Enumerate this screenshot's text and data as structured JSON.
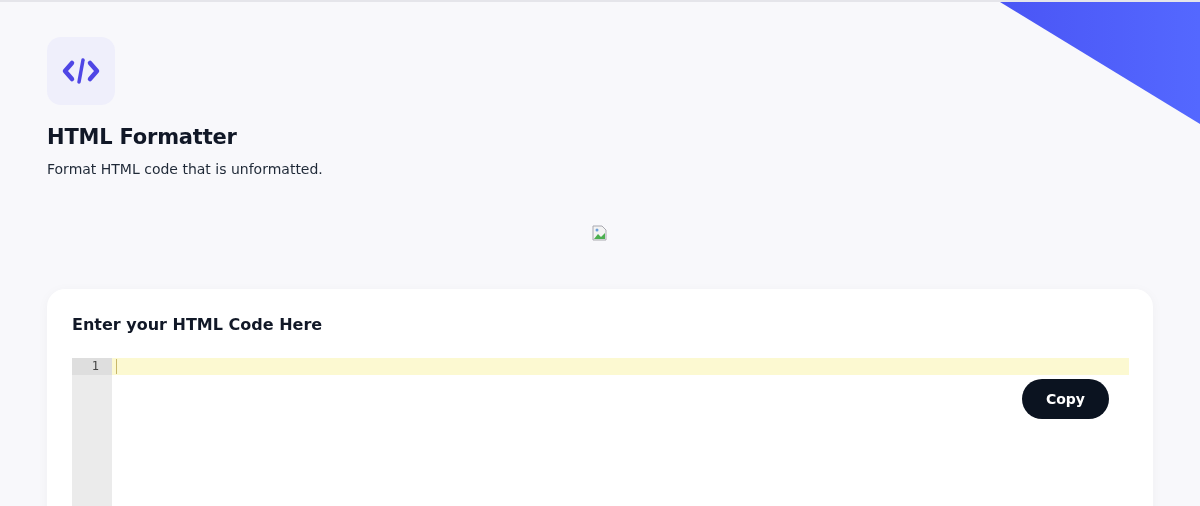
{
  "tool": {
    "title": "HTML Formatter",
    "description": "Format HTML code that is unformatted."
  },
  "editor_card": {
    "heading": "Enter your HTML Code Here",
    "lines": [
      {
        "number": "1",
        "active": true
      }
    ],
    "copy_button": "Copy"
  }
}
